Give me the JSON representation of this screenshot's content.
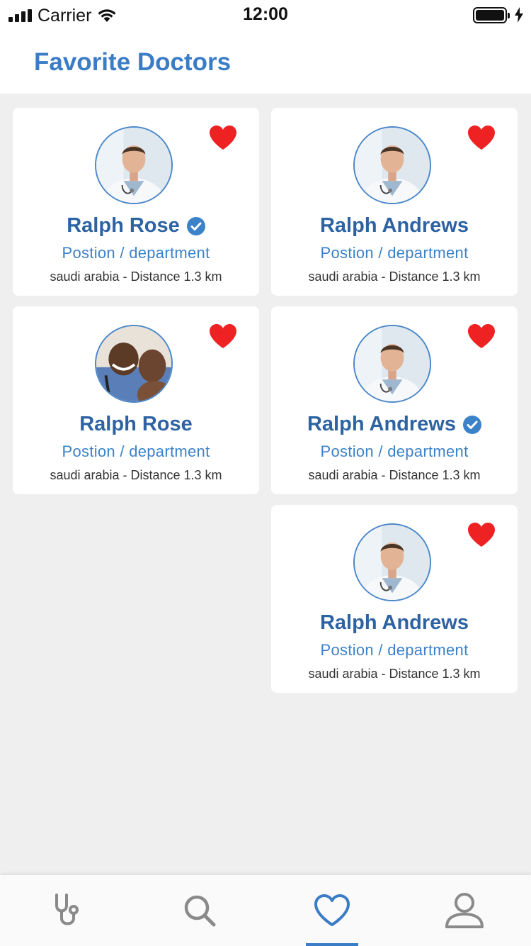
{
  "status_bar": {
    "carrier": "Carrier",
    "time": "12:00"
  },
  "header": {
    "title": "Favorite Doctors"
  },
  "colors": {
    "accent": "#3a7cc6",
    "name": "#2e63a3",
    "heart": "#ee2222",
    "background": "#efefef"
  },
  "doctors": [
    {
      "name": "Ralph Rose",
      "verified": true,
      "position": "Postion / department",
      "location": "saudi arabia - Distance 1.3 km",
      "favorite": true,
      "avatar": "doctor-photo"
    },
    {
      "name": "Ralph Andrews",
      "verified": false,
      "position": "Postion / department",
      "location": "saudi arabia - Distance 1.3 km",
      "favorite": true,
      "avatar": "doctor-photo"
    },
    {
      "name": "Ralph Rose",
      "verified": false,
      "position": "Postion / department",
      "location": "saudi arabia - Distance 1.3 km",
      "favorite": true,
      "avatar": "doctor-with-child-photo"
    },
    {
      "name": "Ralph Andrews",
      "verified": true,
      "position": "Postion / department",
      "location": "saudi arabia - Distance 1.3 km",
      "favorite": true,
      "avatar": "doctor-photo"
    },
    {
      "name": "Ralph Andrews",
      "verified": false,
      "position": "Postion / department",
      "location": "saudi arabia - Distance 1.3 km",
      "favorite": true,
      "avatar": "doctor-photo"
    }
  ],
  "tab_bar": {
    "tabs": [
      {
        "icon": "stethoscope-icon",
        "active": false
      },
      {
        "icon": "search-icon",
        "active": false
      },
      {
        "icon": "heart-icon",
        "active": true
      },
      {
        "icon": "profile-icon",
        "active": false
      }
    ]
  }
}
